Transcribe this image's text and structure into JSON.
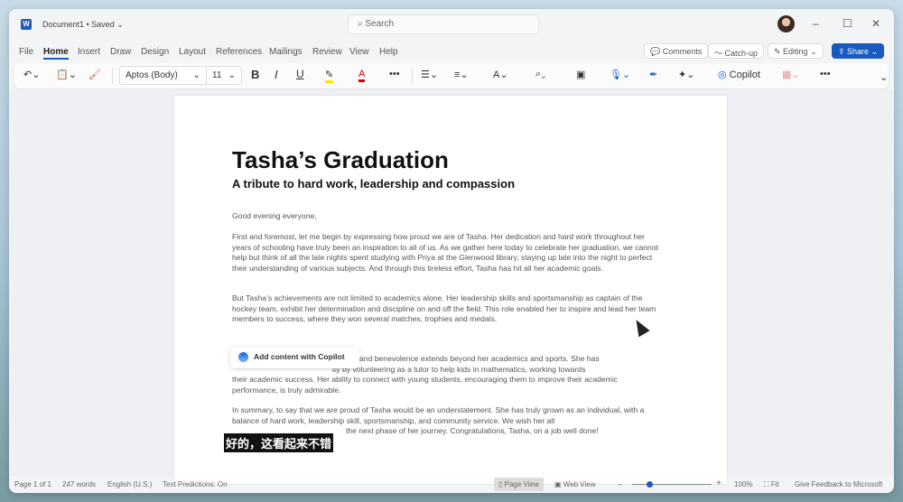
{
  "window": {
    "app_icon": "word-icon",
    "doc_name": "Document1 • Saved ⌄",
    "search_placeholder": "Search",
    "controls": [
      "–",
      "☐",
      "✕"
    ]
  },
  "tabs": [
    "File",
    "Home",
    "Insert",
    "Draw",
    "Design",
    "Layout",
    "References",
    "Mailings",
    "Review",
    "View",
    "Help"
  ],
  "active_tab": "Home",
  "ribbon_buttons": {
    "comments": "Comments",
    "catchup": "Catch-up",
    "editing": "Editing ⌄",
    "share": "Share ⌄"
  },
  "toolbar": {
    "undo": "↶⌄",
    "paste": "📋⌄",
    "format_painter": "🖌",
    "font": "Aptos (Body)",
    "font_size": "11",
    "bold": "B",
    "italic": "I",
    "underline": "U",
    "highlight": "✎",
    "font_color": "A",
    "more": "•••",
    "copilot": "Copilot",
    "accent_color": "#185abd"
  },
  "document": {
    "title": "Tasha’s Graduation",
    "subtitle": "A tribute to hard work, leadership and compassion",
    "paragraphs": [
      "Good evening everyone,",
      "First and foremost, let me begin by expressing how proud we are of Tasha. Her dedication and hard work throughout her years of schooling have truly been an inspiration to all of us. As we gather here today to celebrate her graduation, we cannot help but think of all the late nights spent studying with Priya at the Glenwood library, staying up late into the night to perfect their understanding of various subjects. And through this tireless effort, Tasha has hit all her academic goals.",
      "But Tasha’s achievements are not limited to academics alone. Her leadership skills and sportsmanship as captain of the hockey team, exhibit her determination and discipline on and off the field. This role enabled her to inspire and lead her team members to success, where they won several matches, trophies and medals."
    ],
    "para4_line1": "and benevolence extends beyond her academics and sports. She has",
    "para4_line2": "ity by volunteering as a tutor to help kids in mathematics, working towards",
    "para4_rest": "their academic success. Her ability to connect with young students, encouraging them to improve their academic performance, is truly admirable.",
    "para5": "In summary, to say that we are proud of Tasha would be an understatement. She has truly grown as an individual, with a balance of hard work, leadership skill, sportsmanship, and community service. We wish her all",
    "para5_last": "the next phase of her journey. Congratulations, Tasha, on a job well done!"
  },
  "copilot_popup": "Add content with Copilot",
  "caption": "好的，这看起来不错",
  "status": {
    "page": "Page 1 of 1",
    "words": "247 words",
    "language": "English (U.S.)",
    "predictions": "Text Predictions: On",
    "page_view": "Page View",
    "web_view": "Web View",
    "zoom": "100%",
    "zoom_level": 100,
    "fit": "Fit",
    "feedback": "Give Feedback to Microsoft"
  }
}
